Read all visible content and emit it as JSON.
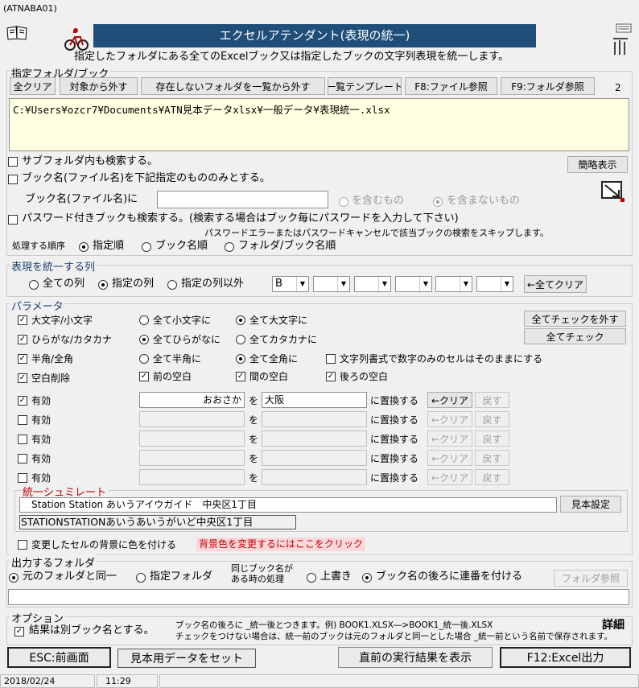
{
  "window": {
    "title": "(ATNABA01)"
  },
  "header": {
    "title": "エクセルアテンダント(表現の統一)",
    "description": "指定したフォルダにある全てのExcelブック又は指定したブックの文字列表現を統一します。"
  },
  "folder_section": {
    "title": "指定フォルダ/ブック",
    "buttons": [
      "全クリア",
      "対象から外す",
      "存在しないフォルダを一覧から外す",
      "一覧テンプレート",
      "F8:ファイル参照",
      "F9:フォルダ参照"
    ],
    "count": "2",
    "path": "C:¥Users¥ozcr7¥Documents¥ATN見本データxlsx¥一般データ¥表現統一.xlsx",
    "subfolder_label": "サブフォルダ内も検索する。",
    "simple_view_button": "簡略表示",
    "bookname_only_label": "ブック名(ファイル名)を下記指定のもののみとする。",
    "bookname_prefix": "ブック名(ファイル名)に",
    "contains_label": "を含むもの",
    "not_contains_label": "を含まないもの",
    "password_label": "パスワード付きブックも検索する。(検索する場合はブック毎にパスワードを入力して下さい)",
    "password_note": "パスワードエラーまたはパスワードキャンセルで該当ブックの検索をスキップします。",
    "order_label": "処理する順序",
    "order_options": [
      "指定順",
      "ブック名順",
      "フォルダ/ブック名順"
    ]
  },
  "columns_section": {
    "title": "表現を統一する列",
    "options": [
      "全ての列",
      "指定の列",
      "指定の列以外"
    ],
    "selects": [
      "B",
      "",
      "",
      "",
      "",
      ""
    ],
    "clear_button": "←全てクリア"
  },
  "params": {
    "title": "パラメータ",
    "rows": [
      {
        "label": "大文字/小文字",
        "opt1": "全て小文字に",
        "opt2": "全て大文字に"
      },
      {
        "label": "ひらがな/カタカナ",
        "opt1": "全てひらがなに",
        "opt2": "全てカタカナに"
      },
      {
        "label": "半角/全角",
        "opt1": "全て半角に",
        "opt2": "全て全角に",
        "extra": "文字列書式で数字のみのセルはそのままにする"
      }
    ],
    "space_label": "空白削除",
    "space_opts": [
      "前の空白",
      "間の空白",
      "後ろの空白"
    ],
    "uncheck_all_button": "全てチェックを外す",
    "check_all_button": "全てチェック",
    "replace_rows": [
      {
        "label": "有効",
        "from": "おおさか",
        "to": "大阪"
      },
      {
        "label": "有効",
        "from": "",
        "to": ""
      },
      {
        "label": "有効",
        "from": "",
        "to": ""
      },
      {
        "label": "有効",
        "from": "",
        "to": ""
      },
      {
        "label": "有効",
        "from": "",
        "to": ""
      }
    ],
    "wo": "を",
    "replace_suffix": "に置換する",
    "clear_btn": "←クリア",
    "undo_btn": "戻す"
  },
  "simulate": {
    "title": "統一シュミレート",
    "input": "Station Station あいうアイウガイド　中央区1丁目",
    "output": "STATIONSTATIONあいうあいうがいど中央区1丁目",
    "sample_button": "見本設定"
  },
  "bgcolor": {
    "label": "変更したセルの背景に色を付ける",
    "link": "背景色を変更するにはここをクリック"
  },
  "output_section": {
    "title": "出力するフォルダ",
    "opt_same": "元のフォルダと同一",
    "opt_specified": "指定フォルダ",
    "same_name_label_1": "同じブック名が",
    "same_name_label_2": "ある時の処理",
    "opt_overwrite": "上書き",
    "opt_serial": "ブック名の後ろに連番を付ける",
    "folder_button": "フォルダ参照",
    "path": ""
  },
  "options": {
    "title": "オプション",
    "separate_label": "結果は別ブック名とする。",
    "note1": "ブック名の後ろに _統一後とつきます。例) BOOK1.XLSX―>BOOK1_統一後.XLSX",
    "note2": "チェックをつけない場合は、統一前のブックは元のフォルダと同一とした場合 _統一前という名前で保存されます。",
    "detail": "詳細"
  },
  "footer_buttons": {
    "esc": "ESC:前画面",
    "sample": "見本用データをセット",
    "last": "直前の実行結果を表示",
    "f12": "F12:Excel出力"
  },
  "status": {
    "date": "2018/02/24",
    "time": "11:29"
  },
  "colors": {
    "header_bg": "#1f4e79",
    "accent_red": "#c00000",
    "link_bg": "#fbd8dc"
  }
}
